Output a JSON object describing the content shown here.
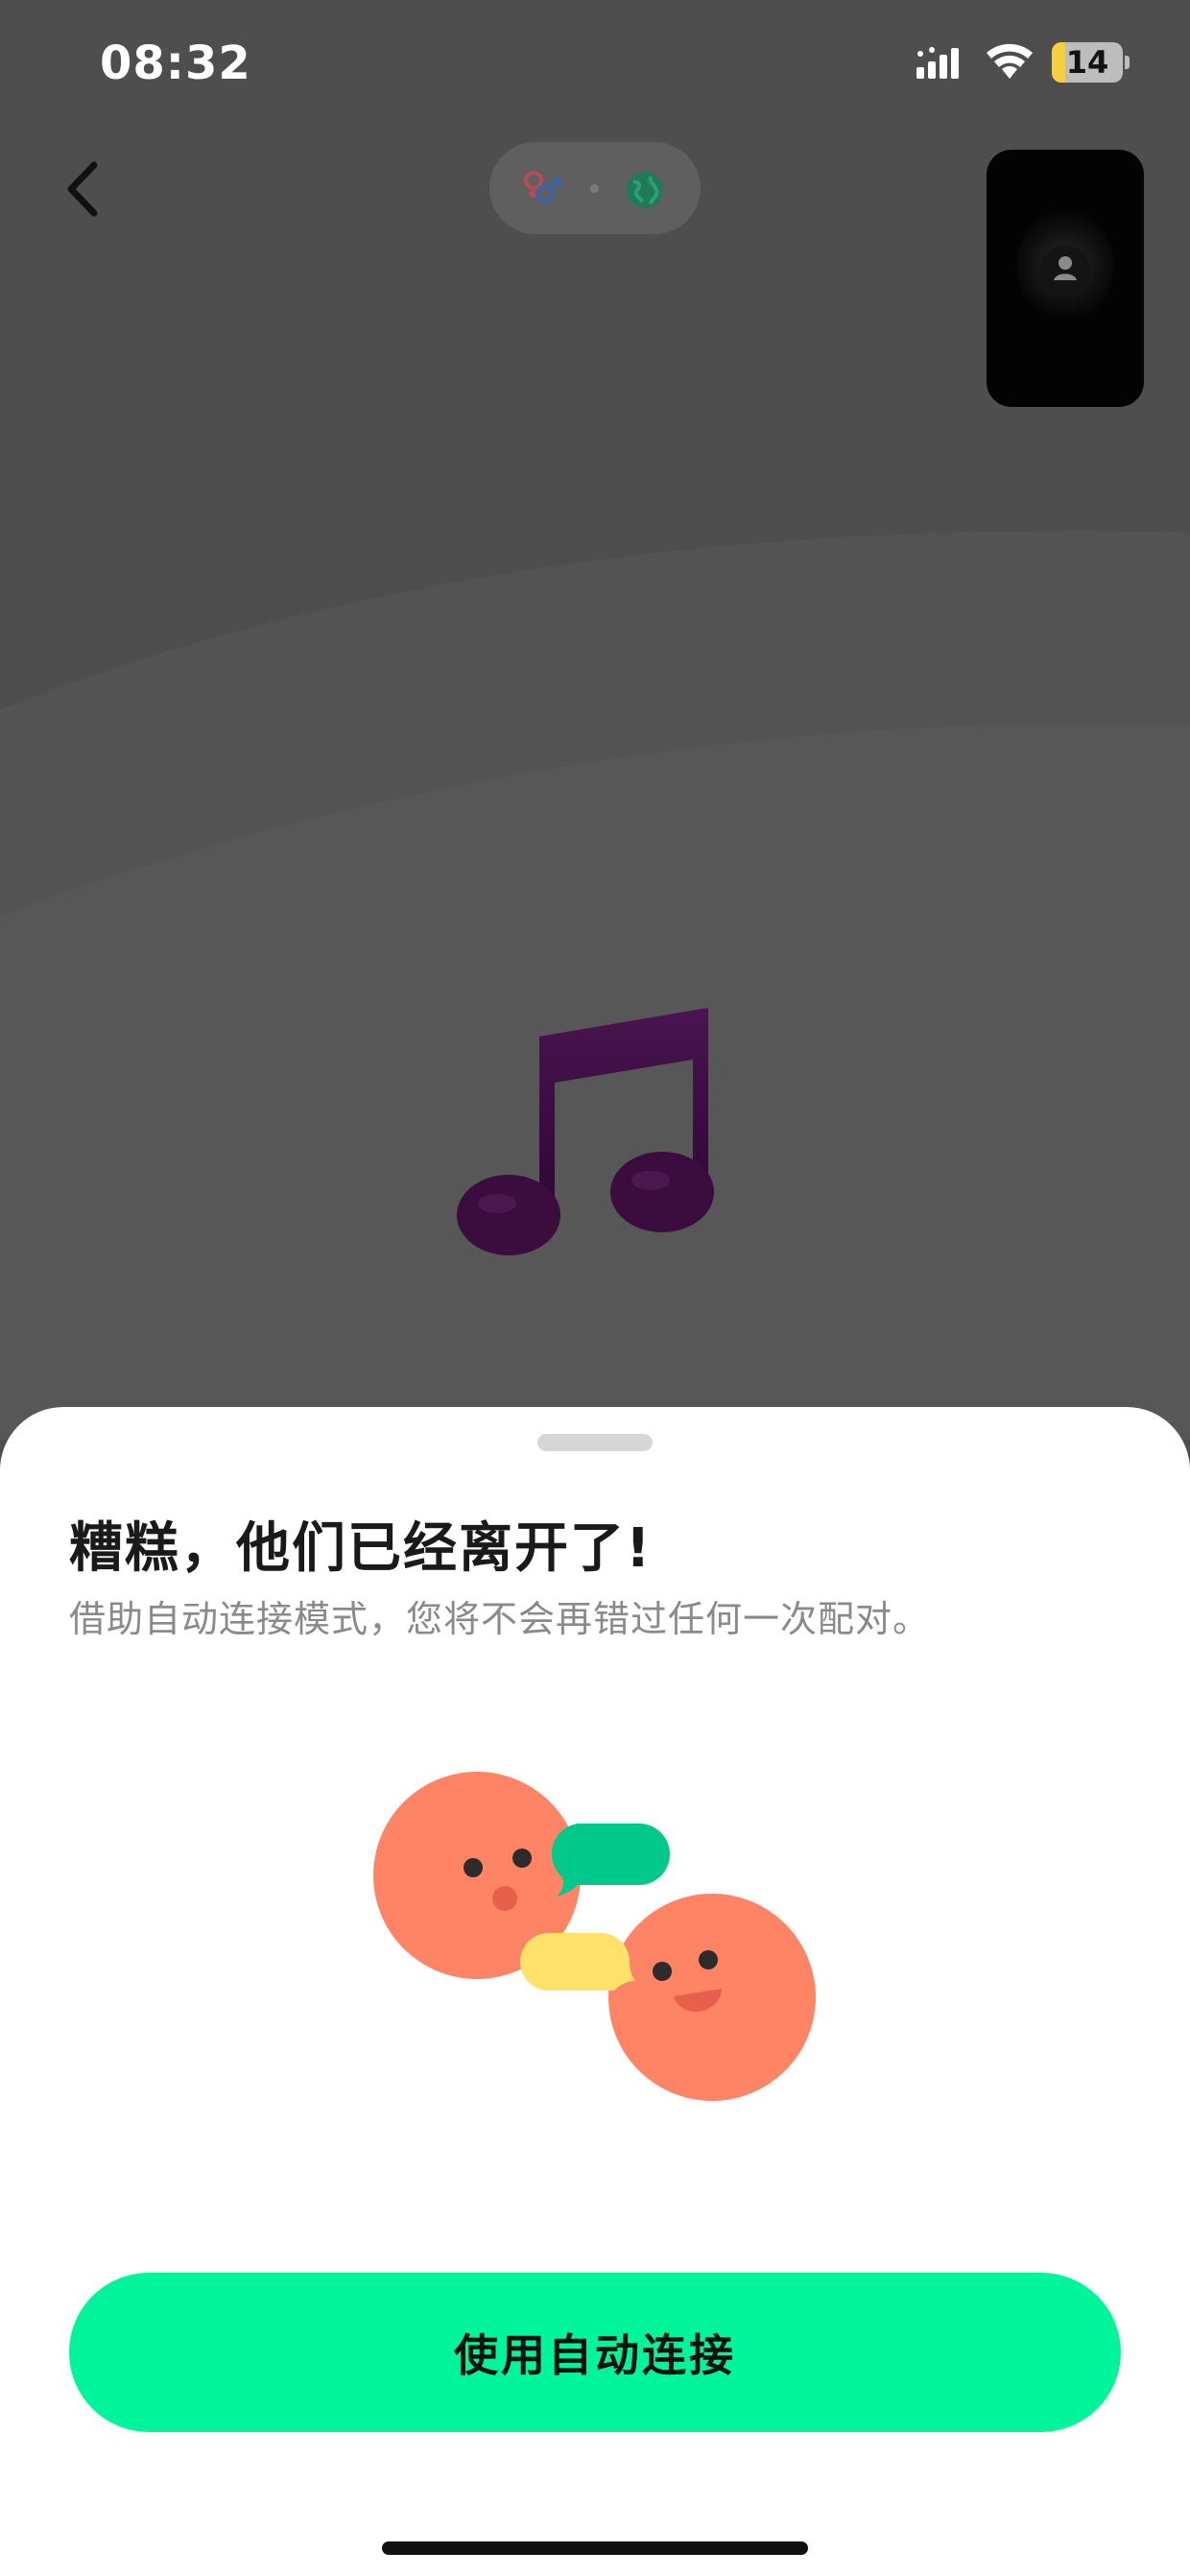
{
  "status_bar": {
    "time": "08:32",
    "battery_level": "14",
    "signal_icon": "cellular-signal-icon",
    "wifi_icon": "wifi-icon",
    "battery_icon": "battery-icon"
  },
  "nav": {
    "back_icon": "chevron-left-icon",
    "filter_icons": [
      "gender-icon",
      "globe-icon"
    ],
    "preview_icon": "self-camera-preview"
  },
  "center": {
    "icon": "music-note-icon",
    "icon_color": "#3a0d3e"
  },
  "sheet": {
    "title": "糟糕，他们已经离开了!",
    "subtitle": "借助自动连接模式，您将不会再错过任何一次配对。",
    "illustration": "chat-faces-illustration",
    "button_label": "使用自动连接",
    "button_color": "#00f59b"
  },
  "colors": {
    "backdrop": "#4e4e4e",
    "face": "#ff8466",
    "bubble_green": "#00c98a",
    "bubble_yellow": "#fde16a"
  }
}
